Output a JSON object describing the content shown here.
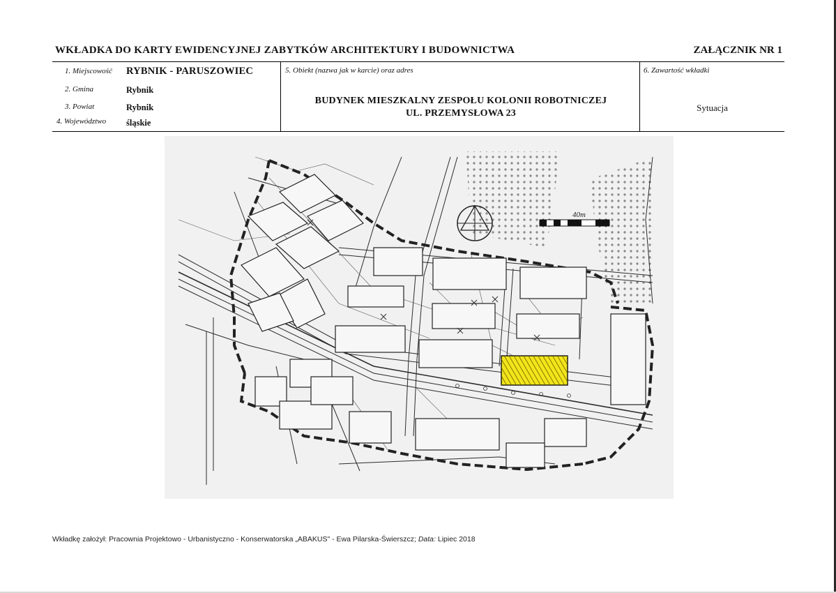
{
  "header": {
    "title": "WKŁADKA DO KARTY EWIDENCYJNEJ ZABYTKÓW ARCHITEKTURY I BUDOWNICTWA",
    "attachment": "ZAŁĄCZNIK NR 1"
  },
  "fields": {
    "locality_label": "1. Miejscowość",
    "locality_value": "RYBNIK - PARUSZOWIEC",
    "commune_label": "2. Gmina",
    "commune_value": "Rybnik",
    "county_label": "3. Powiat",
    "county_value": "Rybnik",
    "voivodeship_label": "4. Województwo",
    "voivodeship_value": "śląskie",
    "object_label": "5. Obiekt (nazwa jak w karcie) oraz adres",
    "object_name_line1": "BUDYNEK MIESZKALNY ZESPOŁU KOLONII ROBOTNICZEJ",
    "object_name_line2": "UL. PRZEMYSŁOWA 23",
    "content_label": "6. Zawartość wkładki",
    "content_value": "Sytuacja"
  },
  "map": {
    "scale_label": "40m",
    "highlight_color": "#f2e51a",
    "hatch_color": "#6b5a00",
    "line_color": "#2b2b2b",
    "icon": "north-compass-icon"
  },
  "footer": {
    "prefix": "Wkładkę założył: Pracownia Projektowo - Urbanistyczno - Konserwatorska „ABAKUS\" - Ewa Pilarska-Świerszcz;",
    "date_label": "Data:",
    "date_value": "Lipiec 2018"
  }
}
